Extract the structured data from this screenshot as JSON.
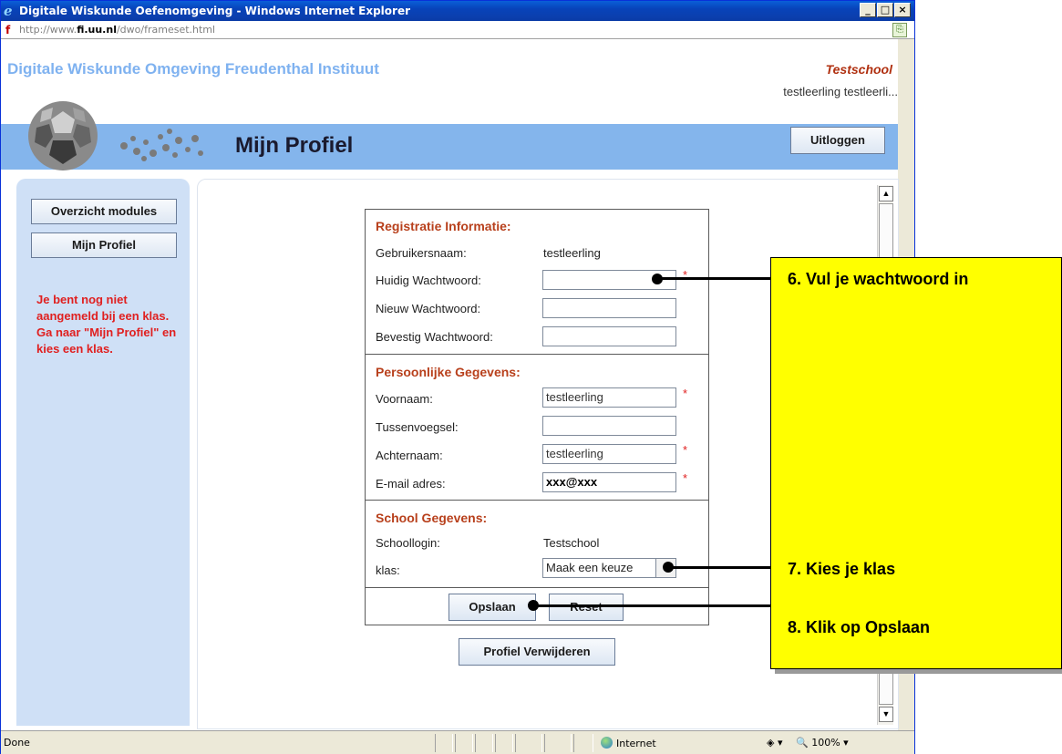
{
  "window": {
    "title": "Digitale Wiskunde Oefenomgeving - Windows Internet Explorer",
    "url_prefix": "http://www.",
    "url_domain": "fi.uu.nl",
    "url_path": "/dwo/frameset.html",
    "controls": {
      "minimize": "_",
      "maximize": "□",
      "close": "×"
    }
  },
  "header": {
    "site_title": "Digitale Wiskunde Omgeving  Freudenthal Instituut",
    "school": "Testschool",
    "user": "testleerling testleerli...",
    "page_title": "Mijn Profiel",
    "logout_label": "Uitloggen"
  },
  "sidebar": {
    "items": [
      {
        "label": "Overzicht modules"
      },
      {
        "label": "Mijn Profiel"
      }
    ],
    "notice": "Je bent nog niet aangemeld bij een klas. Ga naar \"Mijn Profiel\" en kies een klas."
  },
  "form": {
    "registration": {
      "title": "Registratie Informatie:",
      "username_label": "Gebruikersnaam:",
      "username_value": "testleerling",
      "current_password_label": "Huidig Wachtwoord:",
      "new_password_label": "Nieuw Wachtwoord:",
      "confirm_password_label": "Bevestig Wachtwoord:"
    },
    "personal": {
      "title": "Persoonlijke Gegevens:",
      "firstname_label": "Voornaam:",
      "firstname_value": "testleerling",
      "infix_label": "Tussenvoegsel:",
      "infix_value": "",
      "lastname_label": "Achternaam:",
      "lastname_value": "testleerling",
      "email_label": "E-mail adres:",
      "email_value": "xxx@xxx"
    },
    "school": {
      "title": "School Gegevens:",
      "schoollogin_label": "Schoollogin:",
      "schoollogin_value": "Testschool",
      "class_label": "klas:",
      "class_value": "Maak een keuze"
    },
    "required_mark": "*",
    "save_label": "Opslaan",
    "reset_label": "Reset",
    "delete_profile_label": "Profiel Verwijderen"
  },
  "statusbar": {
    "status": "Done",
    "zone": "Internet",
    "zoom": "100%"
  },
  "annotations": [
    {
      "text": "6. Vul je wachtwoord in"
    },
    {
      "text": "7. Kies je klas"
    },
    {
      "text": "8. Klik op Opslaan"
    }
  ],
  "colors": {
    "header_blue": "#b5d2f5",
    "header_strip": "#84b5ec",
    "section_title": "#b8401c",
    "notice_red": "#e02020",
    "callout_yellow": "#ffff00"
  }
}
